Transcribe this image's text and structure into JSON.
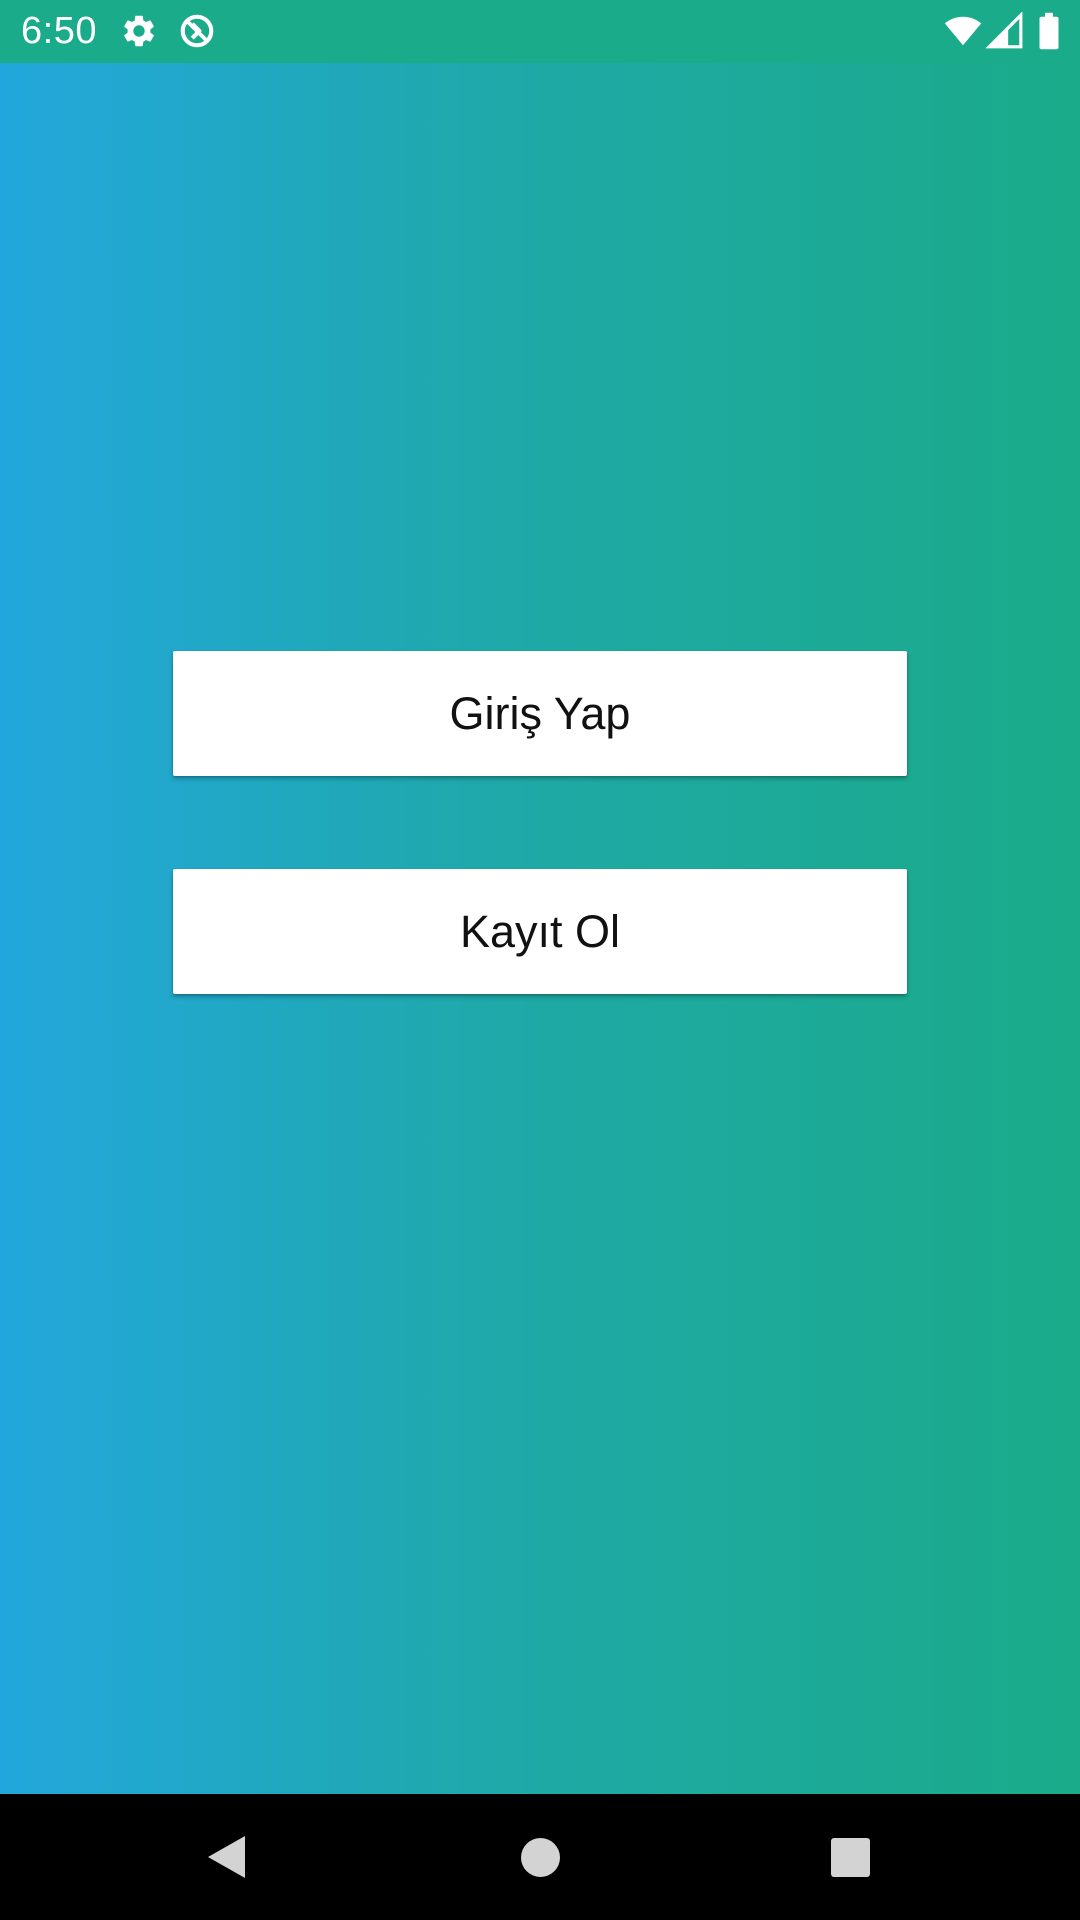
{
  "status_bar": {
    "time": "6:50",
    "background_color": "#1aab8a",
    "left_icons": [
      "settings-gear-icon",
      "sync-disabled-icon"
    ],
    "right_icons": [
      "wifi-icon",
      "cellular-signal-icon",
      "battery-icon"
    ]
  },
  "main": {
    "background_gradient": [
      "#22a7dc",
      "#1aab8a"
    ],
    "login_button_label": "Giriş Yap",
    "register_button_label": "Kayıt Ol"
  },
  "nav_bar": {
    "icons": [
      "back-icon",
      "home-icon",
      "recents-icon"
    ],
    "icon_color": "#d3d3d3"
  }
}
